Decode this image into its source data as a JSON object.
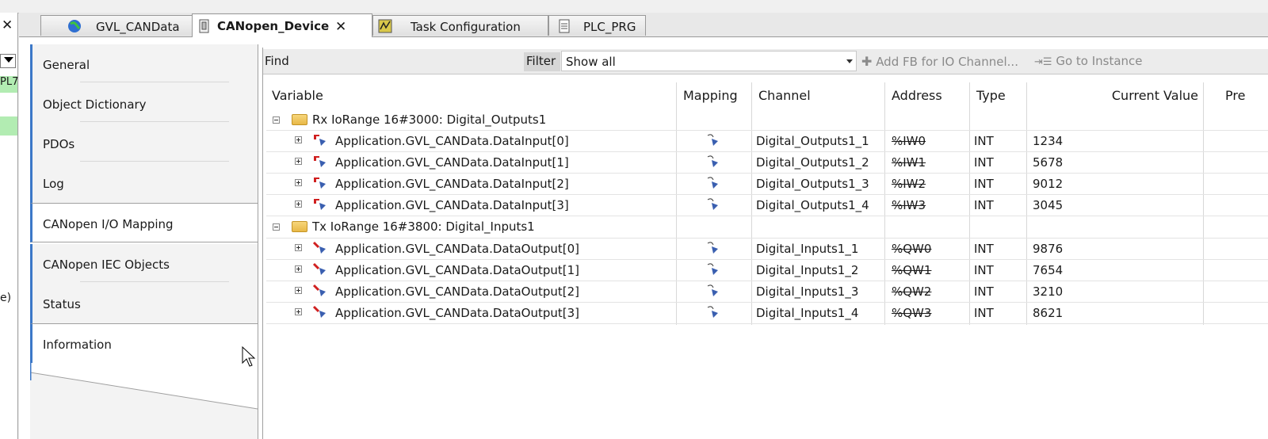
{
  "left_panel": {
    "close_glyph": "✕",
    "green_text": "PL7",
    "partial_text": "e)"
  },
  "tabs": [
    {
      "label": "GVL_CANData",
      "icon": "globe-icon",
      "active": false
    },
    {
      "label": "CANopen_Device",
      "icon": "device-icon",
      "active": true,
      "close": "✕"
    },
    {
      "label": "Task Configuration",
      "icon": "task-config-icon",
      "active": false
    },
    {
      "label": "PLC_PRG",
      "icon": "document-icon",
      "active": false
    }
  ],
  "nav": [
    {
      "label": "General"
    },
    {
      "label": "Object Dictionary"
    },
    {
      "label": "PDOs"
    },
    {
      "label": "Log"
    },
    {
      "label": "CANopen I/O Mapping"
    },
    {
      "label": "CANopen IEC Objects"
    },
    {
      "label": "Status"
    },
    {
      "label": "Information"
    }
  ],
  "toolbar": {
    "find_label": "Find",
    "filter_label": "Filter",
    "filter_value": "Show all",
    "add_fb_label": "Add FB for IO Channel...",
    "goto_label": "Go to Instance"
  },
  "table": {
    "headers": [
      "Variable",
      "Mapping",
      "Channel",
      "Address",
      "Type",
      "Current Value",
      "Pre"
    ],
    "groups": [
      {
        "label": "Rx IoRange 16#3000: Digital_Outputs1",
        "rows": [
          {
            "variable": "Application.GVL_CANData.DataInput[0]",
            "channel": "Digital_Outputs1_1",
            "address": "%IW0",
            "type": "INT",
            "value": "1234"
          },
          {
            "variable": "Application.GVL_CANData.DataInput[1]",
            "channel": "Digital_Outputs1_2",
            "address": "%IW1",
            "type": "INT",
            "value": "5678"
          },
          {
            "variable": "Application.GVL_CANData.DataInput[2]",
            "channel": "Digital_Outputs1_3",
            "address": "%IW2",
            "type": "INT",
            "value": "9012"
          },
          {
            "variable": "Application.GVL_CANData.DataInput[3]",
            "channel": "Digital_Outputs1_4",
            "address": "%IW3",
            "type": "INT",
            "value": "3045"
          }
        ]
      },
      {
        "label": "Tx IoRange 16#3800: Digital_Inputs1",
        "rows": [
          {
            "variable": "Application.GVL_CANData.DataOutput[0]",
            "channel": "Digital_Inputs1_1",
            "address": "%QW0",
            "type": "INT",
            "value": "9876"
          },
          {
            "variable": "Application.GVL_CANData.DataOutput[1]",
            "channel": "Digital_Inputs1_2",
            "address": "%QW1",
            "type": "INT",
            "value": "7654"
          },
          {
            "variable": "Application.GVL_CANData.DataOutput[2]",
            "channel": "Digital_Inputs1_3",
            "address": "%QW2",
            "type": "INT",
            "value": "3210"
          },
          {
            "variable": "Application.GVL_CANData.DataOutput[3]",
            "channel": "Digital_Inputs1_4",
            "address": "%QW3",
            "type": "INT",
            "value": "8621"
          }
        ]
      }
    ]
  },
  "colors": {
    "accent": "#3c78c8",
    "green_highlight": "#b2ecb2",
    "folder": "#e8b847"
  }
}
